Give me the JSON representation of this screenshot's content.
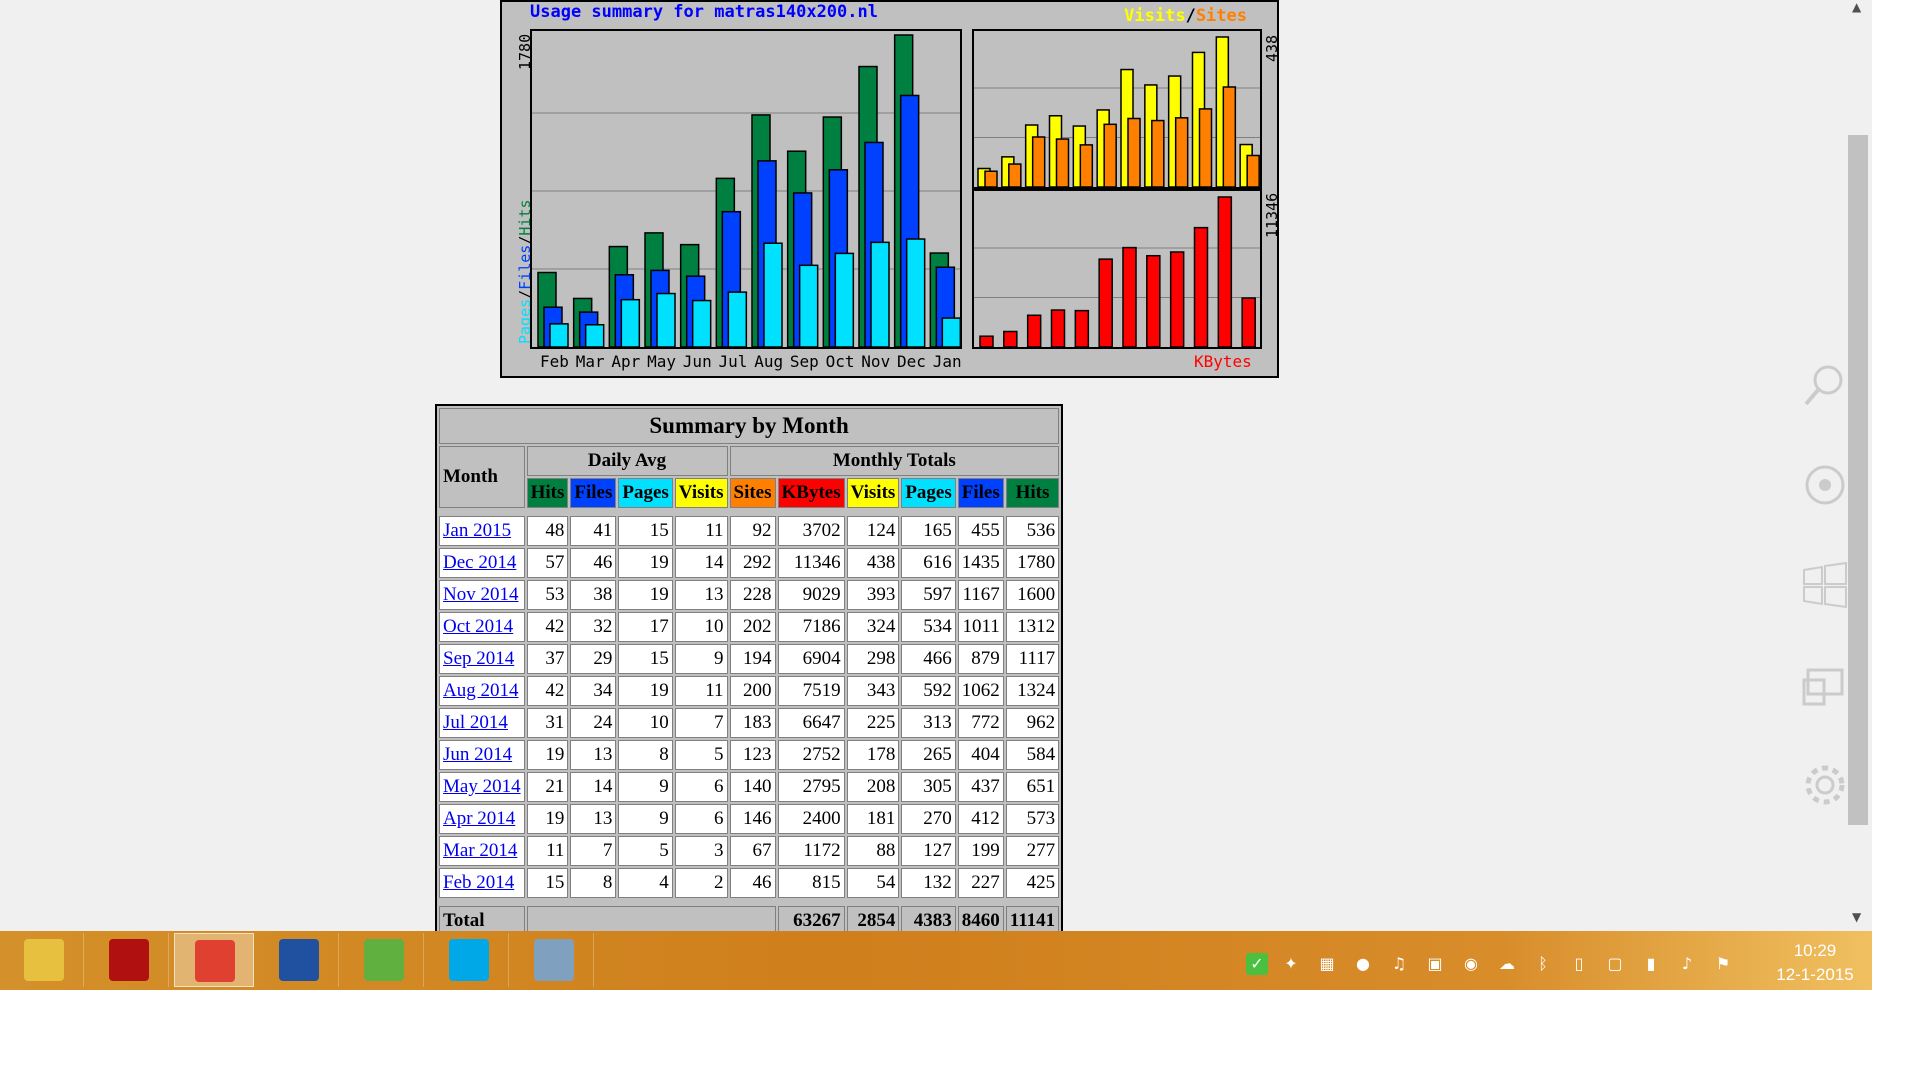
{
  "graph": {
    "title": "Usage summary for matras140x200.nl",
    "legend_visits": "Visits",
    "legend_slash": "/",
    "legend_sites": "Sites",
    "left_axis_max": "1780",
    "left_axis_label_pages": "Pages",
    "left_axis_label_files": "Files",
    "left_axis_label_hits": "Hits",
    "right_top_max": "438",
    "right_bottom_max": "11346",
    "kbytes_label": "KBytes",
    "months": [
      "Feb",
      "Mar",
      "Apr",
      "May",
      "Jun",
      "Jul",
      "Aug",
      "Sep",
      "Oct",
      "Nov",
      "Dec",
      "Jan"
    ],
    "colors": {
      "hits": "#008040",
      "files": "#0040ff",
      "pages": "#00e0ff",
      "visits": "#ffff00",
      "sites": "#ff8000",
      "kbytes": "#ff0000"
    }
  },
  "chart_data": {
    "type": "bar",
    "categories": [
      "Feb",
      "Mar",
      "Apr",
      "May",
      "Jun",
      "Jul",
      "Aug",
      "Sep",
      "Oct",
      "Nov",
      "Dec",
      "Jan"
    ],
    "series": [
      {
        "name": "Hits",
        "values": [
          425,
          277,
          573,
          651,
          584,
          962,
          1324,
          1117,
          1312,
          1600,
          1780,
          536
        ]
      },
      {
        "name": "Files",
        "values": [
          227,
          199,
          412,
          437,
          404,
          772,
          1062,
          879,
          1011,
          1167,
          1435,
          455
        ]
      },
      {
        "name": "Pages",
        "values": [
          132,
          127,
          270,
          305,
          265,
          313,
          592,
          466,
          534,
          597,
          616,
          165
        ]
      },
      {
        "name": "Visits",
        "values": [
          54,
          88,
          181,
          208,
          178,
          225,
          343,
          298,
          324,
          393,
          438,
          124
        ]
      },
      {
        "name": "Sites",
        "values": [
          46,
          67,
          146,
          140,
          123,
          183,
          200,
          194,
          202,
          228,
          292,
          92
        ]
      },
      {
        "name": "KBytes",
        "values": [
          815,
          1172,
          2400,
          2795,
          2752,
          6647,
          7519,
          6904,
          7186,
          9029,
          11346,
          3702
        ]
      }
    ],
    "title": "Usage summary for matras140x200.nl"
  },
  "table": {
    "title": "Summary by Month",
    "month_header": "Month",
    "daily_avg": "Daily Avg",
    "monthly_totals": "Monthly Totals",
    "daily_cols": [
      {
        "label": "Hits",
        "bg": "#008040"
      },
      {
        "label": "Files",
        "bg": "#0040ff"
      },
      {
        "label": "Pages",
        "bg": "#00e0ff"
      },
      {
        "label": "Visits",
        "bg": "#ffff00"
      }
    ],
    "monthly_cols": [
      {
        "label": "Sites",
        "bg": "#ff8000"
      },
      {
        "label": "KBytes",
        "bg": "#ff0000"
      },
      {
        "label": "Visits",
        "bg": "#ffff00"
      },
      {
        "label": "Pages",
        "bg": "#00e0ff"
      },
      {
        "label": "Files",
        "bg": "#0040ff"
      },
      {
        "label": "Hits",
        "bg": "#008040"
      }
    ],
    "rows": [
      {
        "month": "Jan 2015",
        "vals": [
          "48",
          "41",
          "15",
          "11",
          "92",
          "3702",
          "124",
          "165",
          "455",
          "536"
        ]
      },
      {
        "month": "Dec 2014",
        "vals": [
          "57",
          "46",
          "19",
          "14",
          "292",
          "11346",
          "438",
          "616",
          "1435",
          "1780"
        ]
      },
      {
        "month": "Nov 2014",
        "vals": [
          "53",
          "38",
          "19",
          "13",
          "228",
          "9029",
          "393",
          "597",
          "1167",
          "1600"
        ]
      },
      {
        "month": "Oct 2014",
        "vals": [
          "42",
          "32",
          "17",
          "10",
          "202",
          "7186",
          "324",
          "534",
          "1011",
          "1312"
        ]
      },
      {
        "month": "Sep 2014",
        "vals": [
          "37",
          "29",
          "15",
          "9",
          "194",
          "6904",
          "298",
          "466",
          "879",
          "1117"
        ]
      },
      {
        "month": "Aug 2014",
        "vals": [
          "42",
          "34",
          "19",
          "11",
          "200",
          "7519",
          "343",
          "592",
          "1062",
          "1324"
        ]
      },
      {
        "month": "Jul 2014",
        "vals": [
          "31",
          "24",
          "10",
          "7",
          "183",
          "6647",
          "225",
          "313",
          "772",
          "962"
        ]
      },
      {
        "month": "Jun 2014",
        "vals": [
          "19",
          "13",
          "8",
          "5",
          "123",
          "2752",
          "178",
          "265",
          "404",
          "584"
        ]
      },
      {
        "month": "May 2014",
        "vals": [
          "21",
          "14",
          "9",
          "6",
          "140",
          "2795",
          "208",
          "305",
          "437",
          "651"
        ]
      },
      {
        "month": "Apr 2014",
        "vals": [
          "19",
          "13",
          "9",
          "6",
          "146",
          "2400",
          "181",
          "270",
          "412",
          "573"
        ]
      },
      {
        "month": "Mar 2014",
        "vals": [
          "11",
          "7",
          "5",
          "3",
          "67",
          "1172",
          "88",
          "127",
          "199",
          "277"
        ]
      },
      {
        "month": "Feb 2014",
        "vals": [
          "15",
          "8",
          "4",
          "2",
          "46",
          "815",
          "54",
          "132",
          "227",
          "425"
        ]
      }
    ],
    "totals_partial": {
      "label": "Total",
      "vals": [
        "63267",
        "2854",
        "4383",
        "8460",
        "11141"
      ]
    }
  },
  "taskbar": {
    "apps": [
      {
        "name": "file-explorer",
        "color": "#e8c040"
      },
      {
        "name": "filezilla",
        "color": "#b01010"
      },
      {
        "name": "chrome",
        "color": "#e04030"
      },
      {
        "name": "word",
        "color": "#2050a0"
      },
      {
        "name": "notepad-plus",
        "color": "#60b040"
      },
      {
        "name": "skype",
        "color": "#00a8e8"
      },
      {
        "name": "calculator",
        "color": "#80a0c0"
      }
    ],
    "time": "10:29",
    "date": "12-1-2015"
  }
}
